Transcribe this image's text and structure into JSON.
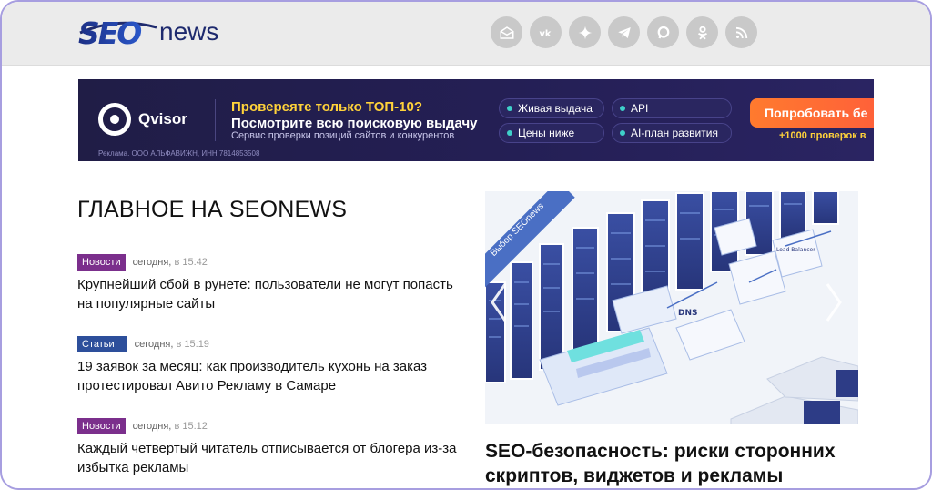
{
  "header": {
    "logo_seo": "SEO",
    "logo_news": "news",
    "socials": [
      "mail-icon",
      "vk-icon",
      "zen-icon",
      "telegram-icon",
      "chat-icon",
      "odnoklassniki-icon",
      "rss-icon"
    ]
  },
  "banner": {
    "brand": "Qvisor",
    "headline_1": "Провереяте только ТОП-10?",
    "headline_2": "Посмотрите всю поисковую выдачу",
    "subline": "Сервис проверки позиций сайтов и конкурентов",
    "legal": "Реклама. ООО АЛЬФАВИЖН, ИНН 7814853508",
    "pills": [
      "Живая выдача",
      "API",
      "Цены ниже",
      "AI-план развития"
    ],
    "cta_label": "Попробовать бе",
    "cta_sub": "+1000 проверок в"
  },
  "main": {
    "section_title": "ГЛАВНОЕ НА SEONEWS",
    "news": [
      {
        "badge": "Новости",
        "date": "сегодня,",
        "time": "в 15:42",
        "title": "Крупнейший сбой в рунете: пользователи не могут попасть на популярные сайты"
      },
      {
        "badge": "Статьи",
        "date": "сегодня,",
        "time": "в 15:19",
        "title": "19 заявок за месяц: как производитель кухонь на заказ протестировал Авито Рекламу в Самаре"
      },
      {
        "badge": "Новости",
        "date": "сегодня,",
        "time": "в 15:12",
        "title": "Каждый четвертый читатель отписывается от блогера из-за избытка рекламы"
      }
    ],
    "hero": {
      "ribbon": "Выбор SEOnews",
      "title": "SEO-безопасность: риски сторонних скриптов, виджетов и рекламы",
      "illustration_labels": [
        "DNS",
        "Load Balancer"
      ]
    }
  },
  "colors": {
    "news_badge": "#7b2f8c",
    "articles_badge": "#2d4f9b",
    "logo_blue": "#1e2a6e",
    "banner_bg": "#221e4c",
    "cta": "#ff6a35"
  }
}
